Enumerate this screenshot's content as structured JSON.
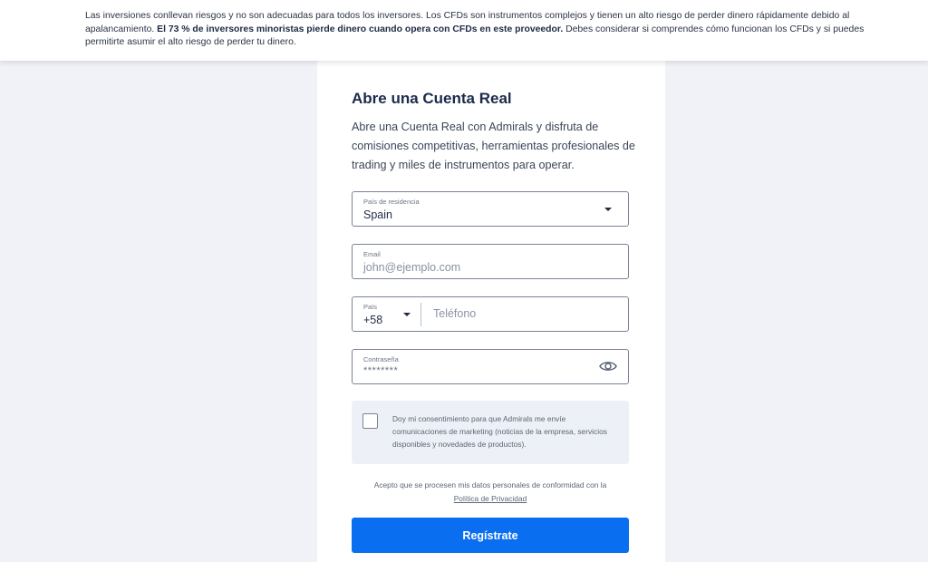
{
  "risk_warning": {
    "part1": "Las inversiones conllevan riesgos y no son adecuadas para todos los inversores. Los CFDs son instrumentos complejos y tienen un alto riesgo de perder dinero rápidamente debido al apalancamiento. ",
    "bold": "El 73 % de inversores minoristas pierde dinero cuando opera con CFDs en este proveedor.",
    "part2": " Debes considerar si comprendes cómo funcionan los CFDs y si puedes permitirte asumir el alto riesgo de perder tu dinero."
  },
  "form": {
    "title": "Abre una Cuenta Real",
    "intro": "Abre una Cuenta Real con Admirals y disfruta de comisiones competitivas, herramientas profesionales de trading y miles de instrumentos para operar.",
    "country": {
      "label": "País de residencia",
      "value": "Spain"
    },
    "email": {
      "label": "Email",
      "placeholder": "john@ejemplo.com"
    },
    "phone": {
      "code_label": "País",
      "code_value": "+58",
      "placeholder": "Teléfono"
    },
    "password": {
      "label": "Contraseña",
      "masked_value": "********"
    },
    "consent": {
      "text": "Doy mi consentimiento para que Admirals me envíe comunicaciones de marketing (noticias de la empresa, servicios disponibles y novedades de productos).",
      "checked": false
    },
    "privacy": {
      "text": "Acepto que se procesen mis datos personales de conformidad con la",
      "link": "Política de Privacidad"
    },
    "submit_label": "Regístrate"
  },
  "colors": {
    "accent": "#0a6ef0",
    "background": "#f0f2f7",
    "title": "#1b2a4a"
  }
}
